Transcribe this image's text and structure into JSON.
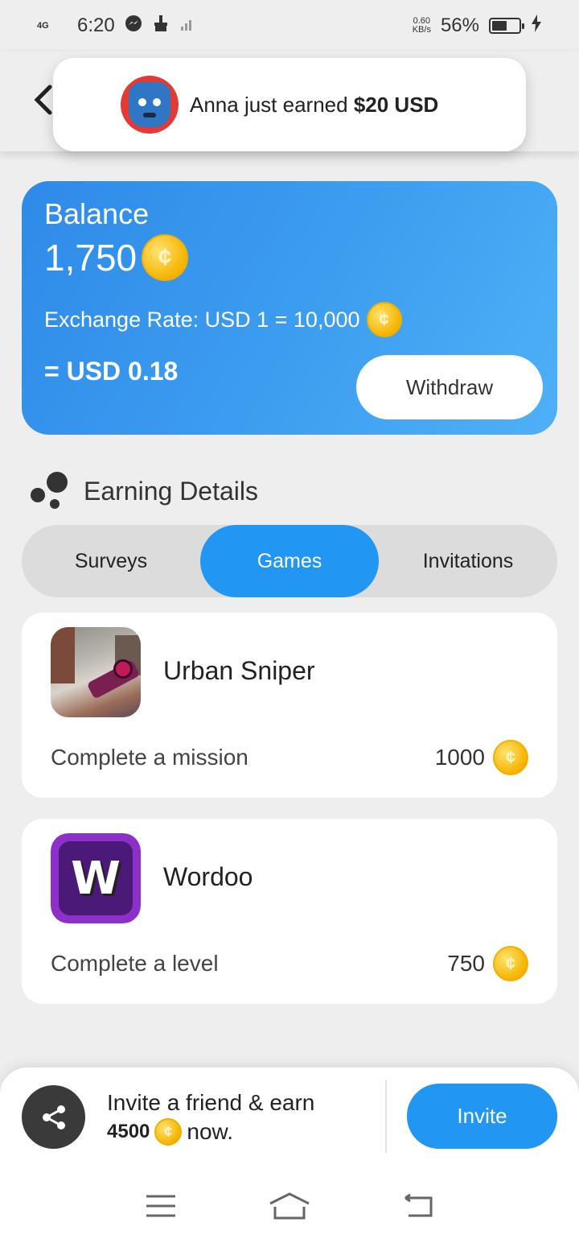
{
  "status_bar": {
    "network": "4G",
    "time": "6:20",
    "data_speed": "0.60",
    "data_unit": "KB/s",
    "battery_percent": "56%",
    "battery_level": 0.56
  },
  "toast": {
    "prefix": "Anna just earned ",
    "amount": "$20 USD"
  },
  "balance": {
    "label": "Balance",
    "amount": "1,750",
    "exchange_rate": "Exchange Rate: USD 1 = 10,000",
    "usd_value": "= USD 0.18",
    "withdraw_label": "Withdraw"
  },
  "earning": {
    "title": "Earning Details",
    "tabs": [
      {
        "label": "Surveys",
        "active": false
      },
      {
        "label": "Games",
        "active": true
      },
      {
        "label": "Invitations",
        "active": false
      }
    ],
    "games": [
      {
        "name": "Urban Sniper",
        "task": "Complete a mission",
        "reward": "1000",
        "icon": "urban-sniper-icon"
      },
      {
        "name": "Wordoo",
        "task": "Complete a level",
        "reward": "750",
        "icon": "wordoo-icon",
        "icon_letter": "W"
      }
    ]
  },
  "invite": {
    "line1": "Invite a friend & earn",
    "amount": "4500",
    "suffix": "now.",
    "button_label": "Invite"
  },
  "colors": {
    "accent": "#2196f3",
    "card_gradient_start": "#2f8ae8",
    "card_gradient_end": "#4fb0f8",
    "coin": "#f5b400"
  }
}
